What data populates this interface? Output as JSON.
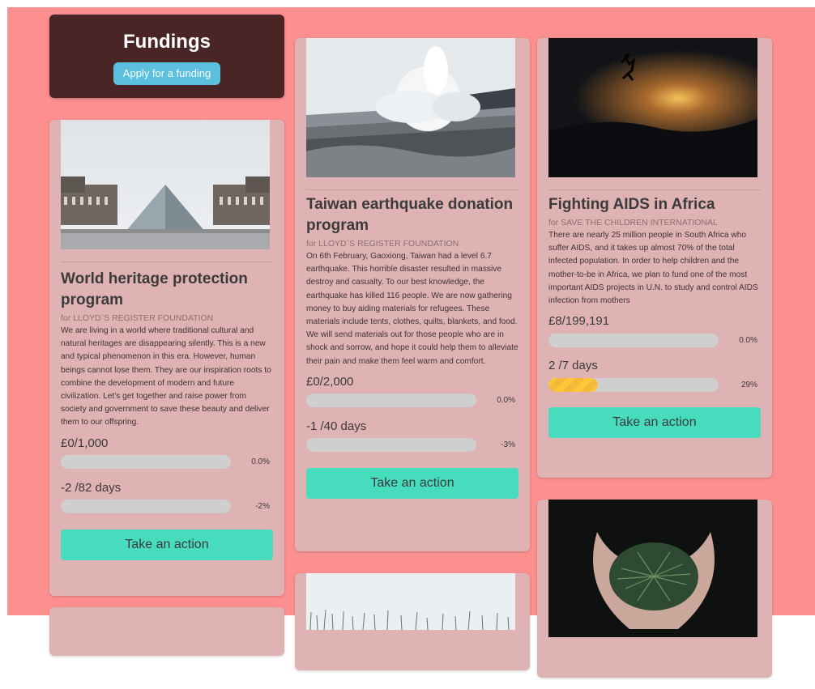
{
  "header": {
    "title": "Fundings",
    "apply_label": "Apply for a funding"
  },
  "theme": {
    "page_bg": "#fd8f8f",
    "card_bg": "#dfb2b3",
    "header_bg": "#4a2526",
    "apply_btn": "#5bc0de",
    "action_btn": "#48dcbf",
    "progress_fill": "#ffc737",
    "progress_track": "#cfcfcf"
  },
  "cards": [
    {
      "image_icon": "louvre-pyramid-photo",
      "title": "World heritage protection program",
      "org": "for LLOYD`S REGISTER FOUNDATION",
      "description": "We are living in a world where traditional cultural and natural heritages are disappearing silently. This is a new and typical phenomenon in this era. However, human beings cannot lose them. They are our inspiration roots to combine the development of modern and future civilization. Let's get together and raise power from society and government to save these beauty and deliver them to our offspring.",
      "amount": "£0/1,000",
      "amount_pct": "0.0%",
      "amount_fill": 0,
      "days": "-2 /82 days",
      "days_pct": "-2%",
      "days_fill": 0,
      "action_label": "Take an action"
    },
    {
      "image_icon": "geyser-eruption-photo",
      "title": "Taiwan earthquake donation program",
      "org": "for LLOYD`S REGISTER FOUNDATION",
      "description": "On 6th February, Gaoxiong, Taiwan had a level 6.7 earthquake. This horrible disaster resulted in massive destroy and casualty. To our best knowledge, the earthquake has killed 116 people. We are now gathering money to buy aiding materials for refugees. These materials include tents, clothes, quilts, blankets, and food. We will send materials out for those people who are in shock and sorrow, and hope it could help them to alleviate their pain and make them feel warm and comfort.",
      "amount": "£0/2,000",
      "amount_pct": "0.0%",
      "amount_fill": 0,
      "days": "-1 /40 days",
      "days_pct": "-3%",
      "days_fill": 0,
      "action_label": "Take an action"
    },
    {
      "image_icon": "sunset-jump-photo",
      "title": "Fighting AIDS in Africa",
      "org": "for SAVE THE CHILDREN INTERNATIONAL",
      "description": "There are nearly 25 million people in South Africa who suffer AIDS, and it takes up almost 70% of the total infected population. In order to help children and the mother-to-be in Africa, we plan to fund one of the most important AIDS projects in U.N. to study and control AIDS infection from mothers",
      "amount": "£8/199,191",
      "amount_pct": "0.0%",
      "amount_fill": 0,
      "days": "2 /7 days",
      "days_pct": "29%",
      "days_fill": 0.29,
      "action_label": "Take an action"
    }
  ],
  "partial_cards": [
    {
      "image_icon": "winter-grass-photo"
    },
    {
      "image_icon": "hands-with-plant-photo"
    }
  ]
}
